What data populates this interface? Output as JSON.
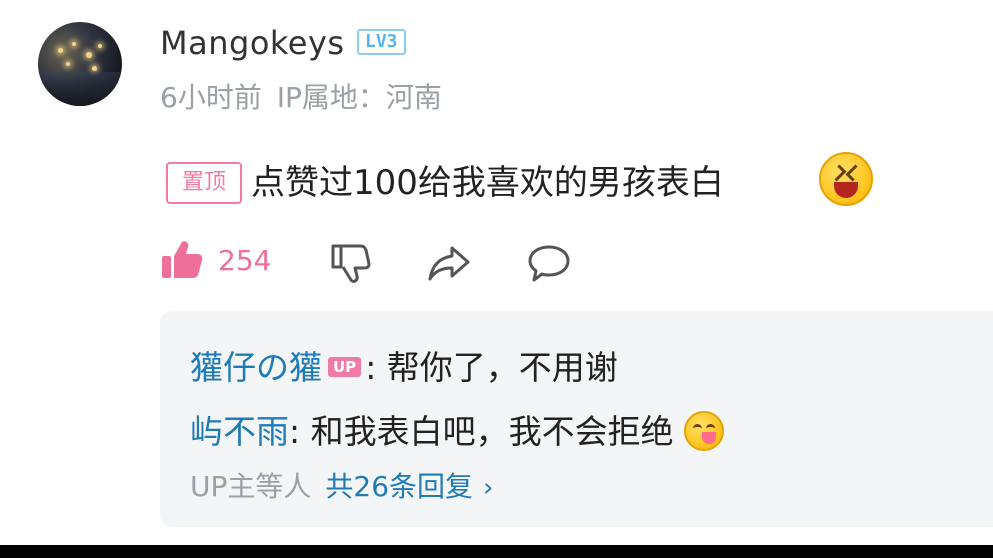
{
  "comment": {
    "username": "Mangokeys",
    "level_badge": "LV3",
    "time_ago": "6小时前",
    "ip_location": "IP属地：河南",
    "pin_label": "置顶",
    "text": "点赞过100给我喜欢的男孩表白",
    "like_count": "254"
  },
  "replies": {
    "items": [
      {
        "user": "獾仔の獾",
        "badge": "UP",
        "sep": ":",
        "text": " 帮你了，不用谢"
      },
      {
        "user": "屿不雨",
        "sep": ":",
        "text": " 和我表白吧，我不会拒绝"
      }
    ],
    "footer_who": "UP主等人",
    "footer_total": "共26条回复",
    "footer_chevron": "›"
  },
  "colors": {
    "accent_pink": "#ef6f9b",
    "link_blue": "#1f7bb6",
    "level_blue": "#56b5ea",
    "meta_gray": "#9aa0a6"
  },
  "icons": [
    "like-icon",
    "dislike-icon",
    "share-icon",
    "reply-icon",
    "face-emoji-icon",
    "yum-emoji-icon"
  ]
}
